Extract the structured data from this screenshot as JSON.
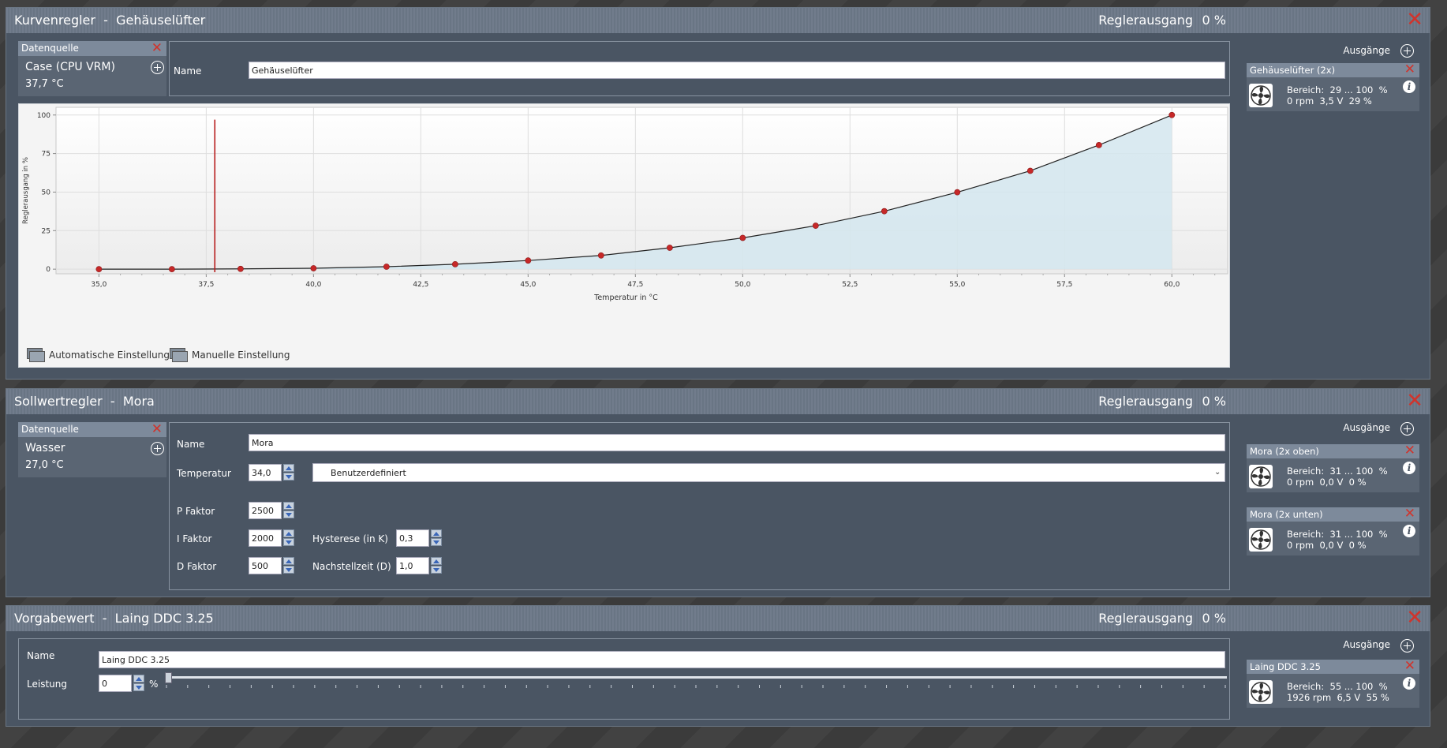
{
  "controllers": [
    {
      "type": "Kurvenregler",
      "sep": "  -  ",
      "name": "Gehäuselüfter",
      "output_label": "Reglerausgang",
      "output_value": "0 %",
      "source": {
        "header": "Datenquelle",
        "name": "Case (CPU VRM)",
        "value": "37,7 °C"
      },
      "fields": {
        "name_label": "Name",
        "name_value": "Gehäuselüfter"
      },
      "outputs_label": "Ausgänge",
      "outputs": [
        {
          "title": "Gehäuselüfter (2x)",
          "line1": "Bereich:  29 ... 100  %",
          "line2": "0 rpm  3,5 V  29 %"
        }
      ],
      "modes": {
        "auto": "Automatische Einstellung",
        "manual": "Manuelle Einstellung"
      }
    },
    {
      "type": "Sollwertregler",
      "sep": "  -  ",
      "name": "Mora",
      "output_label": "Reglerausgang",
      "output_value": "0 %",
      "source": {
        "header": "Datenquelle",
        "name": "Wasser",
        "value": "27,0 °C"
      },
      "fields": {
        "name_label": "Name",
        "name_value": "Mora",
        "temp_label": "Temperatur",
        "temp_value": "34,0",
        "preset_value": "Benutzerdefiniert",
        "p_label": "P Faktor",
        "p_value": "2500",
        "i_label": "I Faktor",
        "i_value": "2000",
        "d_label": "D Faktor",
        "d_value": "500",
        "hyst_label": "Hysterese (in K)",
        "hyst_value": "0,3",
        "reset_label": "Nachstellzeit (D)",
        "reset_value": "1,0"
      },
      "outputs_label": "Ausgänge",
      "outputs": [
        {
          "title": "Mora (2x oben)",
          "line1": "Bereich:  31 ... 100  %",
          "line2": "0 rpm  0,0 V  0 %"
        },
        {
          "title": "Mora (2x unten)",
          "line1": "Bereich:  31 ... 100  %",
          "line2": "0 rpm  0,0 V  0 %"
        }
      ]
    },
    {
      "type": "Vorgabewert",
      "sep": "  -  ",
      "name": "Laing DDC 3.25",
      "output_label": "Reglerausgang",
      "output_value": "0 %",
      "fields": {
        "name_label": "Name",
        "name_value": "Laing DDC 3.25",
        "power_label": "Leistung",
        "power_value": "0",
        "power_unit": "%",
        "power_fraction": 0
      },
      "outputs_label": "Ausgänge",
      "outputs": [
        {
          "title": "Laing DDC 3.25",
          "line1": "Bereich:  55 ... 100  %",
          "line2": "1926 rpm  6,5 V  55 %"
        }
      ]
    }
  ],
  "icons": {
    "close": "close-icon",
    "add": "plus-circle-icon",
    "fan": "fan-icon",
    "info": "info-icon"
  },
  "colors": {
    "close_red": "#d0342c",
    "curve_fill": "#d3e6ee",
    "point": "#c62828",
    "marker": "#b71c1c"
  },
  "chart_data": {
    "type": "line",
    "xlabel": "Temperatur in °C",
    "ylabel": "Reglerausgang in %",
    "xlim": [
      34,
      61.3
    ],
    "ylim": [
      -3,
      105
    ],
    "xticks": [
      35,
      37.5,
      40,
      42.5,
      45,
      47.5,
      50,
      52.5,
      55,
      57.5,
      60
    ],
    "xtick_labels": [
      "35,0",
      "37,5",
      "40,0",
      "42,5",
      "45,0",
      "47,5",
      "50,0",
      "52,5",
      "55,0",
      "57,5",
      "60,0"
    ],
    "yticks": [
      0,
      25,
      50,
      75,
      100
    ],
    "ytick_labels": [
      "0",
      "25",
      "50",
      "75",
      "100"
    ],
    "grid": true,
    "current_marker_x": 37.7,
    "x": [
      35,
      36.7,
      38.3,
      40,
      41.7,
      43.3,
      45,
      46.7,
      48.3,
      50,
      51.7,
      53.3,
      55,
      56.7,
      58.3,
      60
    ],
    "values": [
      0,
      0,
      0.2,
      0.6,
      1.6,
      3.2,
      5.6,
      8.9,
      13.9,
      20.3,
      28.2,
      37.6,
      49.9,
      63.8,
      80.5,
      100
    ]
  }
}
